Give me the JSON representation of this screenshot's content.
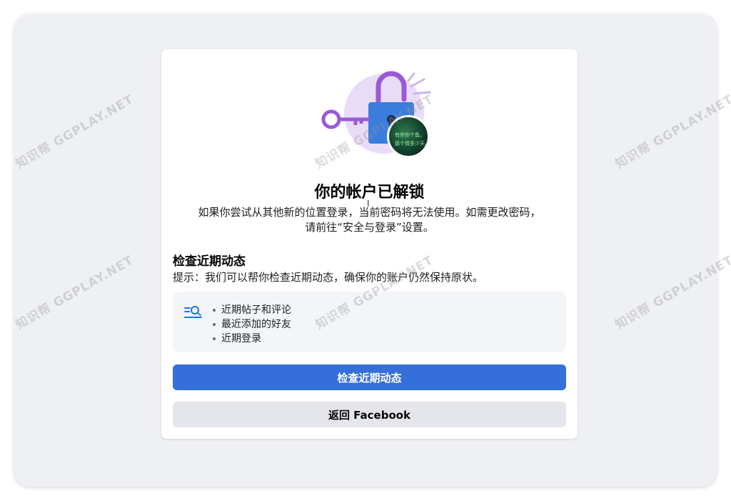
{
  "card": {
    "title": "你的帐户已解锁",
    "subtitle_line1": "如果你尝试从其他新的位置登录，当前密码将无法使用。如需更改密码，",
    "subtitle_line2": "请前往“安全与登录”设置。",
    "section_heading": "检查近期动态",
    "tip": "提示：我们可以帮你检查近期动态，确保你的账户仍然保持原状。",
    "checklist": [
      "近期帖子和评论",
      "最近添加的好友",
      "近期登录"
    ],
    "primary_button": "检查近期动态",
    "secondary_button": "返回 Facebook"
  },
  "avatar": {
    "line1": "有些你个鱼。",
    "line2": "那个情多少天。"
  },
  "watermark": {
    "text": "知识帮 GGPLAY.NET"
  },
  "colors": {
    "primary": "#356fd9",
    "secondary_bg": "#e4e6eb",
    "lock_purple": "#9a5ad6",
    "lock_blue": "#3b7ddd",
    "icon_blue": "#1877f2"
  },
  "icons": {
    "hero": "unlocked-padlock-key-icon",
    "checklist": "search-list-icon"
  }
}
